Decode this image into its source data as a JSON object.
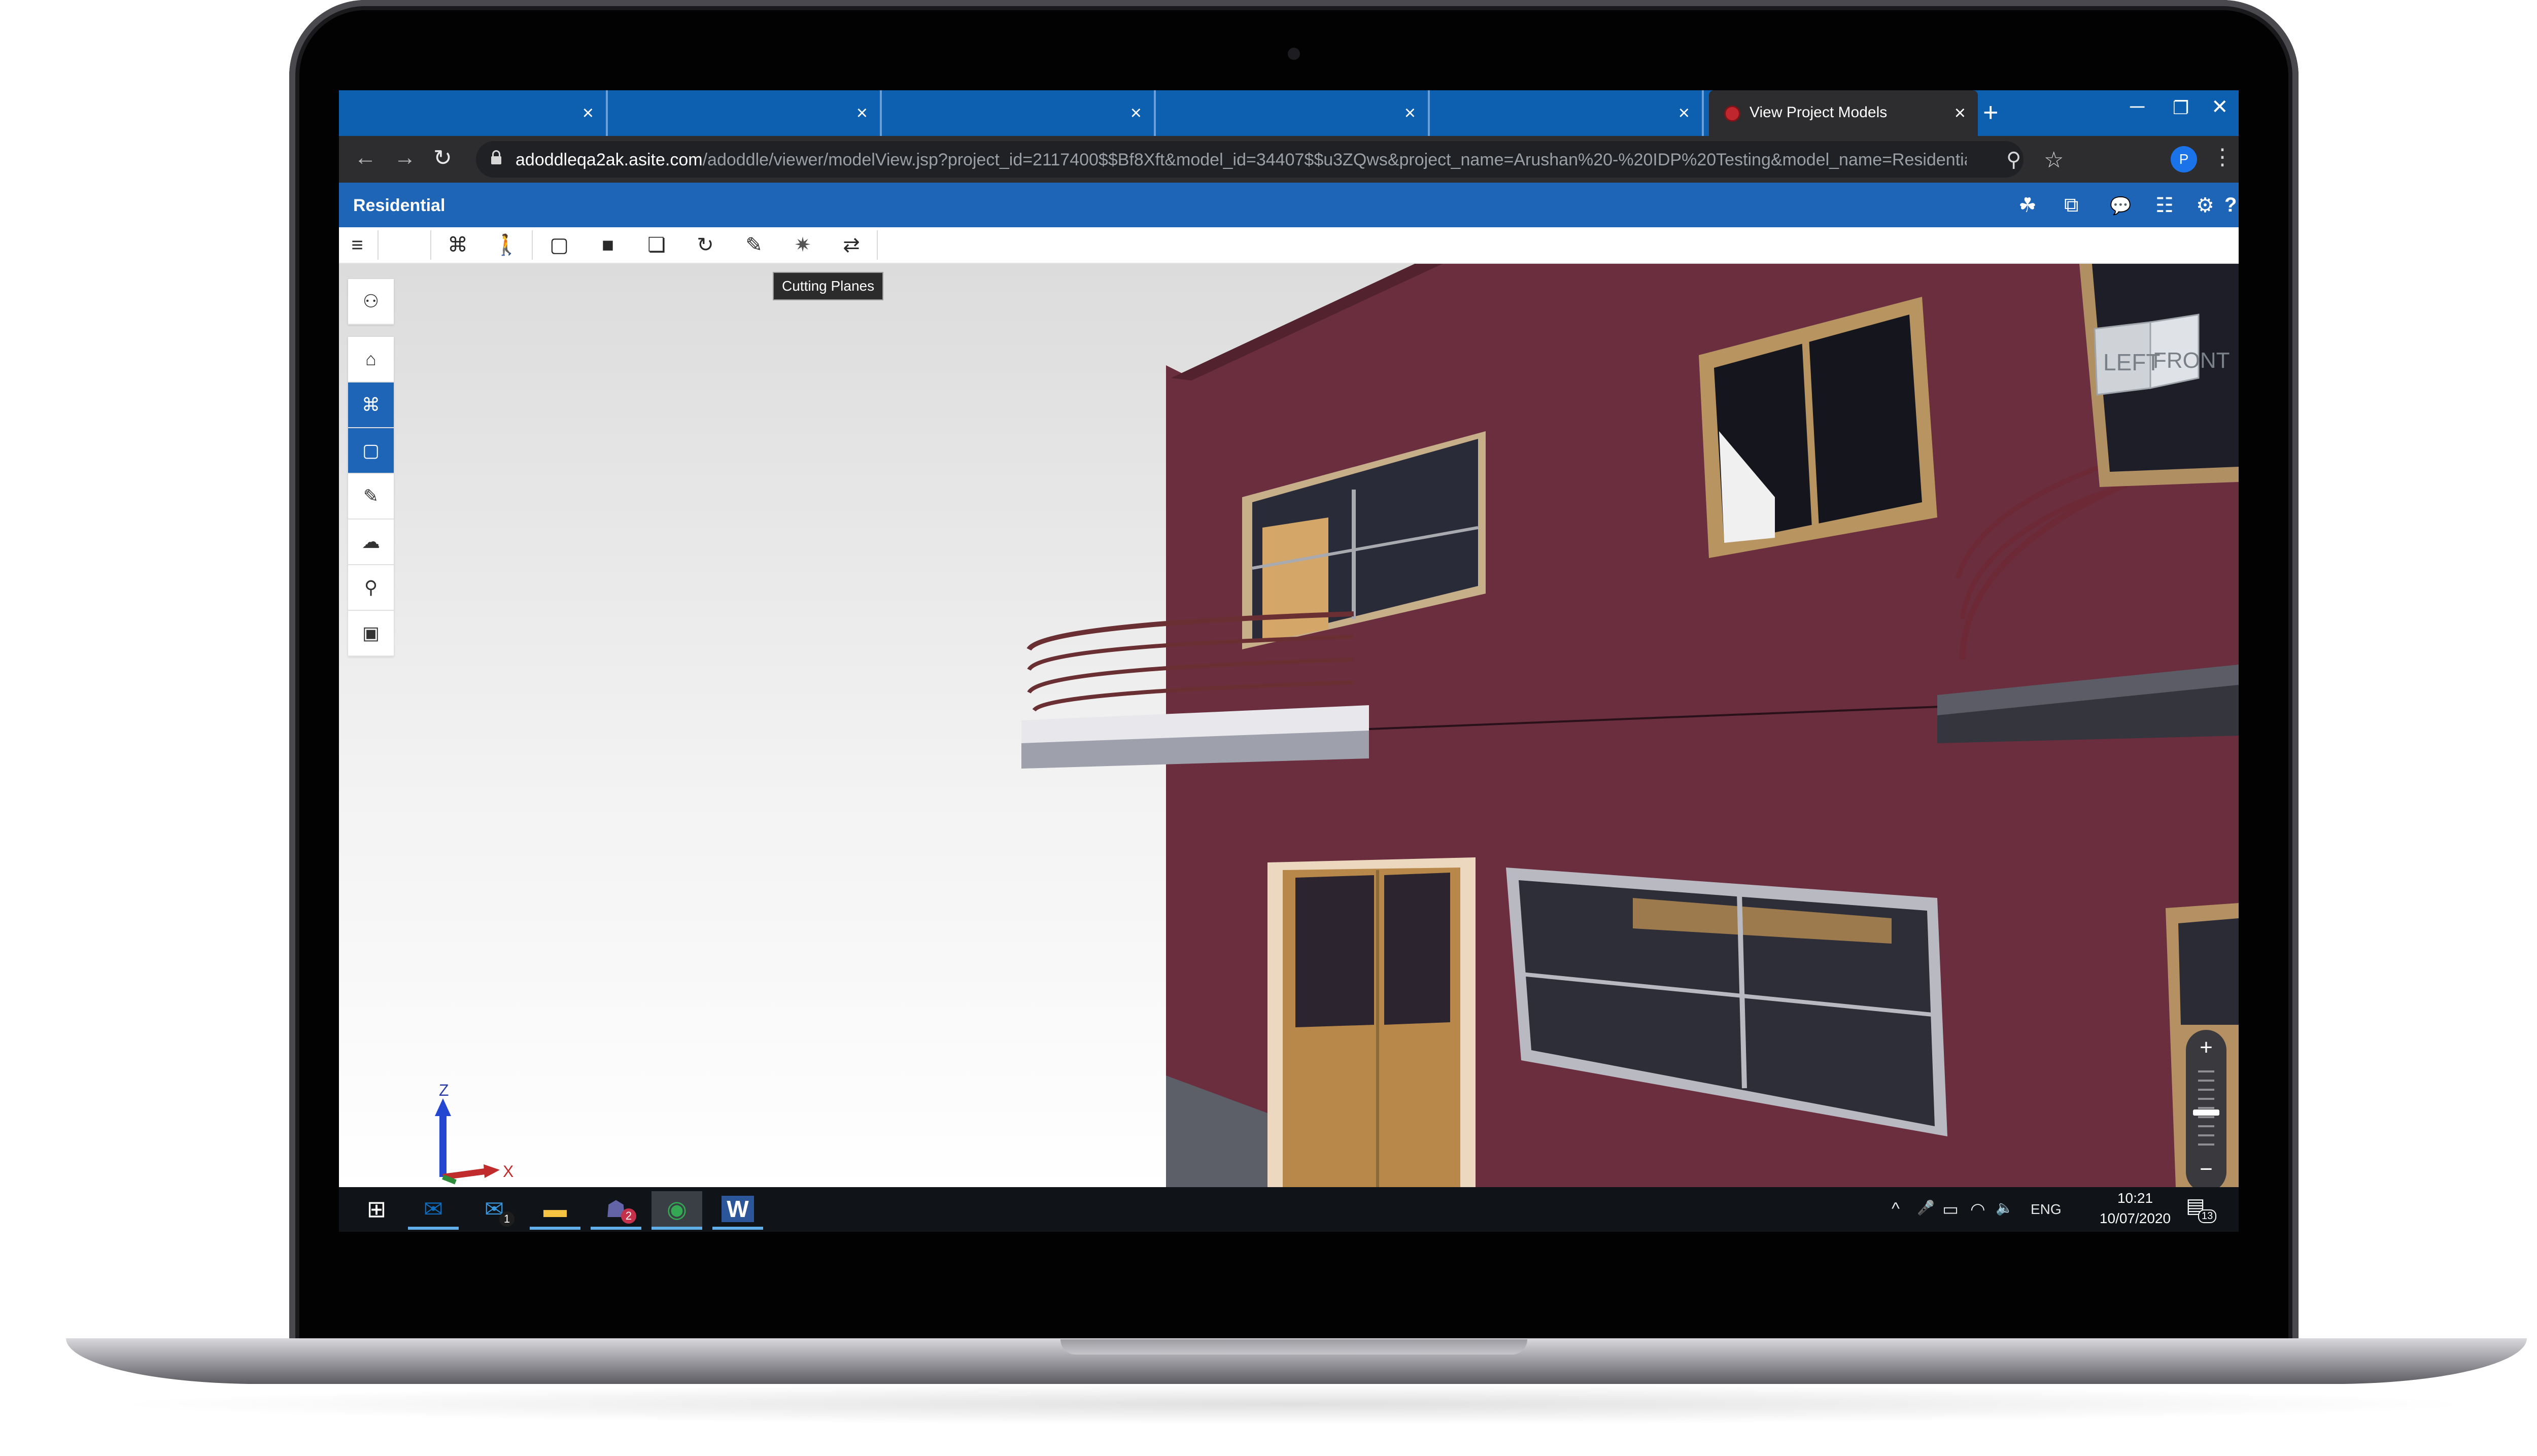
{
  "browser": {
    "tabs": [
      {
        "title": "",
        "close": "×"
      },
      {
        "title": "",
        "close": "×"
      },
      {
        "title": "",
        "close": "×"
      },
      {
        "title": "",
        "close": "×"
      },
      {
        "title": "",
        "close": "×"
      },
      {
        "title": "View Project Models",
        "close": "×"
      }
    ],
    "new_tab": "+",
    "window_controls": {
      "minimize": "─",
      "restore": "❐",
      "close": "✕"
    },
    "url_host": "adoddleqa2ak.asite.com",
    "url_path": "/adoddle/viewer/modelView.jsp?project_id=2117400$$Bf8Xft&model_id=34407$$u3ZQws&project_name=Arushan%20-%20IDP%20Testing&model_name=Residential&toOpe...",
    "profile_initial": "P",
    "nav": {
      "back": "←",
      "forward": "→",
      "reload": "↻"
    }
  },
  "app": {
    "title": "Residential",
    "header_icons": [
      "model-share-icon",
      "compare-icon",
      "comments-icon",
      "notes-icon",
      "settings-icon",
      "help-icon"
    ],
    "header_glyphs": [
      "☘",
      "⧉",
      "💬",
      "☷",
      "⚙",
      "?"
    ],
    "help_label": "?"
  },
  "toolbar": {
    "menu": "≡",
    "buttons": [
      {
        "name": "model-tree-toggle-icon",
        "glyph": "⌘"
      },
      {
        "name": "walk-mode-icon",
        "glyph": "🚶"
      },
      {
        "name": "section-box-icon",
        "glyph": "▢"
      },
      {
        "name": "solid-view-icon",
        "glyph": "■"
      },
      {
        "name": "layers-icon",
        "glyph": "❏"
      },
      {
        "name": "reset-view-icon",
        "glyph": "↻"
      },
      {
        "name": "markup-icon",
        "glyph": "✎"
      },
      {
        "name": "cutting-planes-icon",
        "glyph": "✷"
      },
      {
        "name": "swap-icon",
        "glyph": "⇄"
      }
    ],
    "tooltip": "Cutting Planes"
  },
  "left_panel": {
    "buttons": [
      {
        "name": "hierarchy-icon",
        "glyph": "⚇",
        "active": false
      },
      {
        "name": "home-icon",
        "glyph": "⌂",
        "active": false
      },
      {
        "name": "object-tree-icon",
        "glyph": "⌘",
        "active": true
      },
      {
        "name": "section-icon",
        "glyph": "▢",
        "active": true
      },
      {
        "name": "measure-icon",
        "glyph": "✎",
        "active": false
      },
      {
        "name": "cloud-icon",
        "glyph": "☁",
        "active": false
      },
      {
        "name": "properties-icon",
        "glyph": "⚲",
        "active": false
      },
      {
        "name": "viewer-settings-icon",
        "glyph": "▣",
        "active": false
      }
    ]
  },
  "viewcube": {
    "left": "LEFT",
    "front": "FRONT"
  },
  "axis": {
    "z": "Z",
    "x": "X"
  },
  "zoom": {
    "plus": "+",
    "minus": "−",
    "level": 0.45
  },
  "taskbar": {
    "start": "⊞",
    "apps": [
      {
        "name": "outlook-icon",
        "glyph": "✉",
        "color": "#0f6cbd",
        "running": true,
        "focused": false,
        "badge": ""
      },
      {
        "name": "mail-icon",
        "glyph": "✉",
        "color": "#3a96dd",
        "running": false,
        "focused": false,
        "badge": "1"
      },
      {
        "name": "file-explorer-icon",
        "glyph": "▬",
        "color": "#f5c242",
        "running": true,
        "focused": false,
        "badge": ""
      },
      {
        "name": "teams-icon",
        "glyph": "☗",
        "color": "#6264a7",
        "running": true,
        "focused": false,
        "badge": "2"
      },
      {
        "name": "chrome-icon",
        "glyph": "◉",
        "color": "#34a853",
        "running": true,
        "focused": true,
        "badge": ""
      },
      {
        "name": "word-icon",
        "glyph": "W",
        "color": "#2b579a",
        "running": true,
        "focused": false,
        "badge": ""
      }
    ],
    "tray": {
      "chevron": "^",
      "mic": "🎤",
      "battery": "▭",
      "wifi": "◠",
      "volume": "🔈",
      "lang": "ENG"
    },
    "time": "10:21",
    "date": "10/07/2020",
    "notifications": "13"
  },
  "colors": {
    "tab_strip": "#0d5fb0",
    "app_header": "#1e65b7",
    "wall": "#6a2e3e",
    "taskbar": "#101419"
  }
}
